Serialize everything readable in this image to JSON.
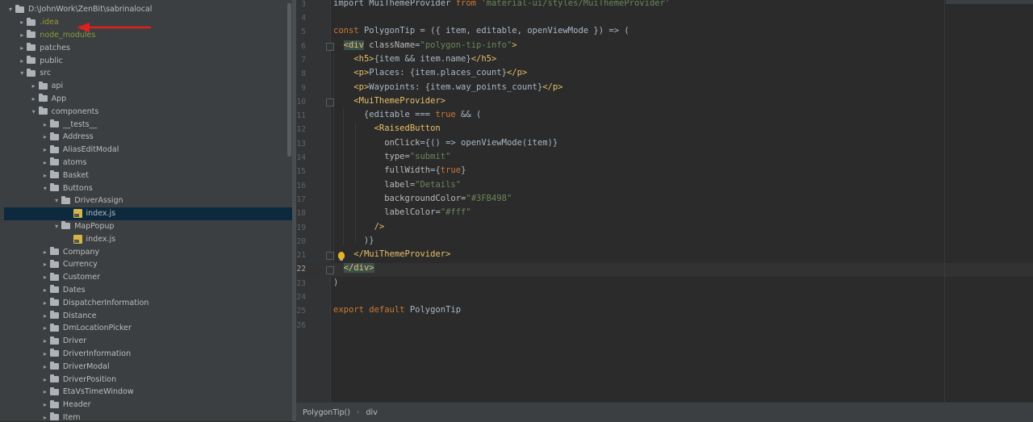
{
  "project_tree": {
    "items": [
      {
        "label": "D:\\JohnWork\\ZenBit\\sabrinalocal",
        "type": "folder",
        "expanded": true,
        "depth": 0
      },
      {
        "label": ".idea",
        "type": "folder",
        "expanded": false,
        "depth": 1,
        "style": "ignored"
      },
      {
        "label": "node_modules",
        "type": "folder",
        "expanded": false,
        "depth": 1,
        "style": "excluded"
      },
      {
        "label": "patches",
        "type": "folder",
        "expanded": false,
        "depth": 1
      },
      {
        "label": "public",
        "type": "folder",
        "expanded": false,
        "depth": 1
      },
      {
        "label": "src",
        "type": "folder",
        "expanded": true,
        "depth": 1
      },
      {
        "label": "api",
        "type": "folder",
        "expanded": false,
        "depth": 2
      },
      {
        "label": "App",
        "type": "folder",
        "expanded": false,
        "depth": 2
      },
      {
        "label": "components",
        "type": "folder",
        "expanded": true,
        "depth": 2
      },
      {
        "label": "__tests__",
        "type": "folder",
        "expanded": false,
        "depth": 3
      },
      {
        "label": "Address",
        "type": "folder",
        "expanded": false,
        "depth": 3
      },
      {
        "label": "AliasEditModal",
        "type": "folder",
        "expanded": false,
        "depth": 3
      },
      {
        "label": "atoms",
        "type": "folder",
        "expanded": false,
        "depth": 3
      },
      {
        "label": "Basket",
        "type": "folder",
        "expanded": false,
        "depth": 3
      },
      {
        "label": "Buttons",
        "type": "folder",
        "expanded": true,
        "depth": 3
      },
      {
        "label": "DriverAssign",
        "type": "folder",
        "expanded": true,
        "depth": 4
      },
      {
        "label": "index.js",
        "type": "js",
        "depth": 5,
        "selected": true
      },
      {
        "label": "MapPopup",
        "type": "folder",
        "expanded": true,
        "depth": 4
      },
      {
        "label": "index.js",
        "type": "js",
        "depth": 5
      },
      {
        "label": "Company",
        "type": "folder",
        "expanded": false,
        "depth": 3
      },
      {
        "label": "Currency",
        "type": "folder",
        "expanded": false,
        "depth": 3
      },
      {
        "label": "Customer",
        "type": "folder",
        "expanded": false,
        "depth": 3
      },
      {
        "label": "Dates",
        "type": "folder",
        "expanded": false,
        "depth": 3
      },
      {
        "label": "DispatcherInformation",
        "type": "folder",
        "expanded": false,
        "depth": 3
      },
      {
        "label": "Distance",
        "type": "folder",
        "expanded": false,
        "depth": 3
      },
      {
        "label": "DmLocationPicker",
        "type": "folder",
        "expanded": false,
        "depth": 3
      },
      {
        "label": "Driver",
        "type": "folder",
        "expanded": false,
        "depth": 3
      },
      {
        "label": "DriverInformation",
        "type": "folder",
        "expanded": false,
        "depth": 3
      },
      {
        "label": "DriverModal",
        "type": "folder",
        "expanded": false,
        "depth": 3
      },
      {
        "label": "DriverPosition",
        "type": "folder",
        "expanded": false,
        "depth": 3
      },
      {
        "label": "EtaVsTimeWindow",
        "type": "folder",
        "expanded": false,
        "depth": 3
      },
      {
        "label": "Header",
        "type": "folder",
        "expanded": false,
        "depth": 3
      },
      {
        "label": "Item",
        "type": "folder",
        "expanded": false,
        "depth": 3
      }
    ]
  },
  "editor": {
    "current_line": 22,
    "lines": [
      {
        "num": "3",
        "tokens": [
          [
            "plain",
            "import MuiThemeProvider "
          ],
          [
            "kw",
            "from "
          ],
          [
            "str",
            "'material-ui/styles/MuiThemeProvider'"
          ]
        ]
      },
      {
        "num": "4",
        "tokens": []
      },
      {
        "num": "5",
        "tokens": [
          [
            "kw",
            "const "
          ],
          [
            "plain",
            "PolygonTip = ({ item, editable, openViewMode }) => ("
          ]
        ]
      },
      {
        "num": "6",
        "tokens": [
          [
            "plain",
            "  "
          ],
          [
            "hltag",
            "<div"
          ],
          [
            "attr",
            " className"
          ],
          [
            "plain",
            "="
          ],
          [
            "str",
            "\"polygon-tip-info\""
          ],
          [
            "tag",
            ">"
          ]
        ]
      },
      {
        "num": "7",
        "tokens": [
          [
            "plain",
            "    "
          ],
          [
            "tag",
            "<h5>"
          ],
          [
            "plain",
            "{item && item.name}"
          ],
          [
            "tag",
            "</h5>"
          ]
        ]
      },
      {
        "num": "8",
        "tokens": [
          [
            "plain",
            "    "
          ],
          [
            "tag",
            "<p>"
          ],
          [
            "plain",
            "Places: {item.places_count}"
          ],
          [
            "tag",
            "</p>"
          ]
        ]
      },
      {
        "num": "9",
        "tokens": [
          [
            "plain",
            "    "
          ],
          [
            "tag",
            "<p>"
          ],
          [
            "plain",
            "Waypoints: {item.way_points_count}"
          ],
          [
            "tag",
            "</p>"
          ]
        ]
      },
      {
        "num": "10",
        "tokens": [
          [
            "plain",
            "    "
          ],
          [
            "tag",
            "<MuiThemeProvider>"
          ]
        ]
      },
      {
        "num": "11",
        "tokens": [
          [
            "plain",
            "      {editable === "
          ],
          [
            "kw",
            "true "
          ],
          [
            "plain",
            "&& ("
          ]
        ]
      },
      {
        "num": "12",
        "tokens": [
          [
            "plain",
            "        "
          ],
          [
            "tag",
            "<RaisedButton"
          ]
        ]
      },
      {
        "num": "13",
        "tokens": [
          [
            "plain",
            "          "
          ],
          [
            "attr",
            "onClick"
          ],
          [
            "plain",
            "={() => openViewMode(item)}"
          ]
        ]
      },
      {
        "num": "14",
        "tokens": [
          [
            "plain",
            "          "
          ],
          [
            "attr",
            "type"
          ],
          [
            "plain",
            "="
          ],
          [
            "str",
            "\"submit\""
          ]
        ]
      },
      {
        "num": "15",
        "tokens": [
          [
            "plain",
            "          "
          ],
          [
            "attr",
            "fullWidth"
          ],
          [
            "plain",
            "={"
          ],
          [
            "kw",
            "true"
          ],
          [
            "plain",
            "}"
          ]
        ]
      },
      {
        "num": "16",
        "tokens": [
          [
            "plain",
            "          "
          ],
          [
            "attr",
            "label"
          ],
          [
            "plain",
            "="
          ],
          [
            "str",
            "\"Details\""
          ]
        ]
      },
      {
        "num": "17",
        "tokens": [
          [
            "plain",
            "          "
          ],
          [
            "attr",
            "backgroundColor"
          ],
          [
            "plain",
            "="
          ],
          [
            "str",
            "\"#3FB498\""
          ]
        ]
      },
      {
        "num": "18",
        "tokens": [
          [
            "plain",
            "          "
          ],
          [
            "attr",
            "labelColor"
          ],
          [
            "plain",
            "="
          ],
          [
            "str",
            "\"#fff\""
          ]
        ]
      },
      {
        "num": "19",
        "tokens": [
          [
            "plain",
            "        "
          ],
          [
            "tag",
            "/>"
          ]
        ]
      },
      {
        "num": "20",
        "tokens": [
          [
            "plain",
            "      )}"
          ]
        ]
      },
      {
        "num": "21",
        "tokens": [
          [
            "plain",
            "    "
          ],
          [
            "tag",
            "</MuiThemeProvider>"
          ]
        ]
      },
      {
        "num": "22",
        "tokens": [
          [
            "plain",
            "  "
          ],
          [
            "hltag",
            "</div>"
          ]
        ]
      },
      {
        "num": "23",
        "tokens": [
          [
            "plain",
            ")"
          ]
        ]
      },
      {
        "num": "24",
        "tokens": []
      },
      {
        "num": "25",
        "tokens": [
          [
            "kw",
            "export default "
          ],
          [
            "plain",
            "PolygonTip"
          ]
        ]
      },
      {
        "num": "26",
        "tokens": []
      }
    ]
  },
  "breadcrumb": {
    "items": [
      "PolygonTip()",
      "div"
    ],
    "separator": "›"
  },
  "colors": {
    "keyword": "#cc7832",
    "string": "#6a8759",
    "tag": "#e8bf6a",
    "selection": "#0d293e",
    "annotation_arrow": "#e0201e"
  }
}
